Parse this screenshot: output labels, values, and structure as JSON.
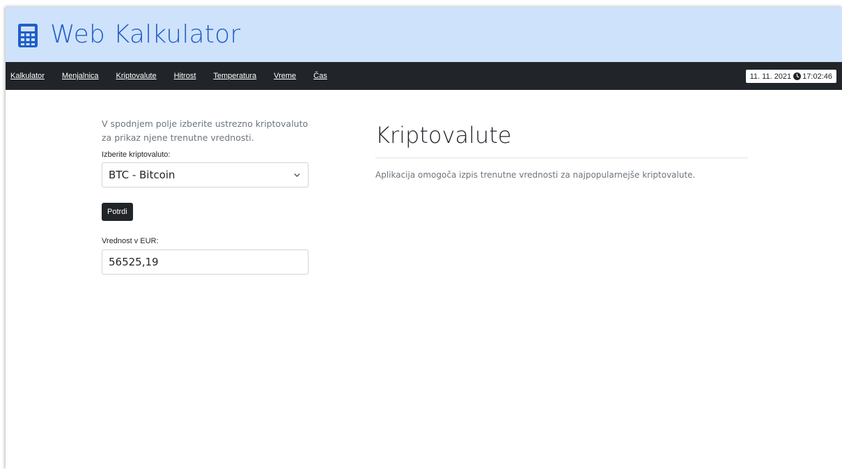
{
  "header": {
    "title": "Web Kalkulator",
    "icon": "calculator-icon",
    "background": "#cfe2fb",
    "title_color": "#1f5fc7"
  },
  "nav": {
    "items": [
      {
        "label": "Kalkulator"
      },
      {
        "label": "Menjalnica"
      },
      {
        "label": "Kriptovalute"
      },
      {
        "label": "Hitrost"
      },
      {
        "label": "Temperatura"
      },
      {
        "label": "Vreme"
      },
      {
        "label": "Čas"
      }
    ],
    "clock": {
      "date": "11. 11. 2021",
      "icon": "clock-icon",
      "time": "17:02:46"
    },
    "background": "#212529"
  },
  "form": {
    "intro": "V spodnjem polje izberite ustrezno kriptovaluto za prikaz njene trenutne vrednosti.",
    "select_label": "Izberite kriptovaluto:",
    "select_value": "BTC - Bitcoin",
    "submit_label": "Potrdi",
    "output_label": "Vrednost v EUR:",
    "output_value": "56525,19"
  },
  "main": {
    "heading": "Kriptovalute",
    "description": "Aplikacija omogoča izpis trenutne vrednosti za najpopularnejše kriptovalute."
  }
}
